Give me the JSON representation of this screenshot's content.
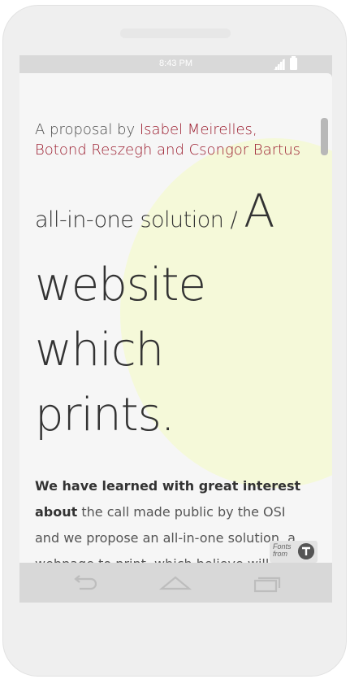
{
  "status_bar": {
    "time": "8:43 PM"
  },
  "byline": {
    "prefix": "A proposal by ",
    "authors": "Isabel Meirelles, Botond Reszegh and Csongor Bartus"
  },
  "headline": {
    "small": "all-in-one solution / ",
    "big_a": "A",
    "line1": "website",
    "line2": "which",
    "line3": "prints."
  },
  "body": {
    "lead": "We have learned with great interest about",
    "rest": " the call made public by the OSI and we propose an all-in-one solution, a webpage to print, which believe will be the most"
  },
  "badge": {
    "text": "Fonts from"
  },
  "colors": {
    "accent": "#9b1c2e",
    "blob": "#f5f9d9"
  },
  "icons": [
    "signal-icon",
    "battery-icon",
    "back-icon",
    "home-icon",
    "recents-icon",
    "fonts-logo-icon"
  ]
}
